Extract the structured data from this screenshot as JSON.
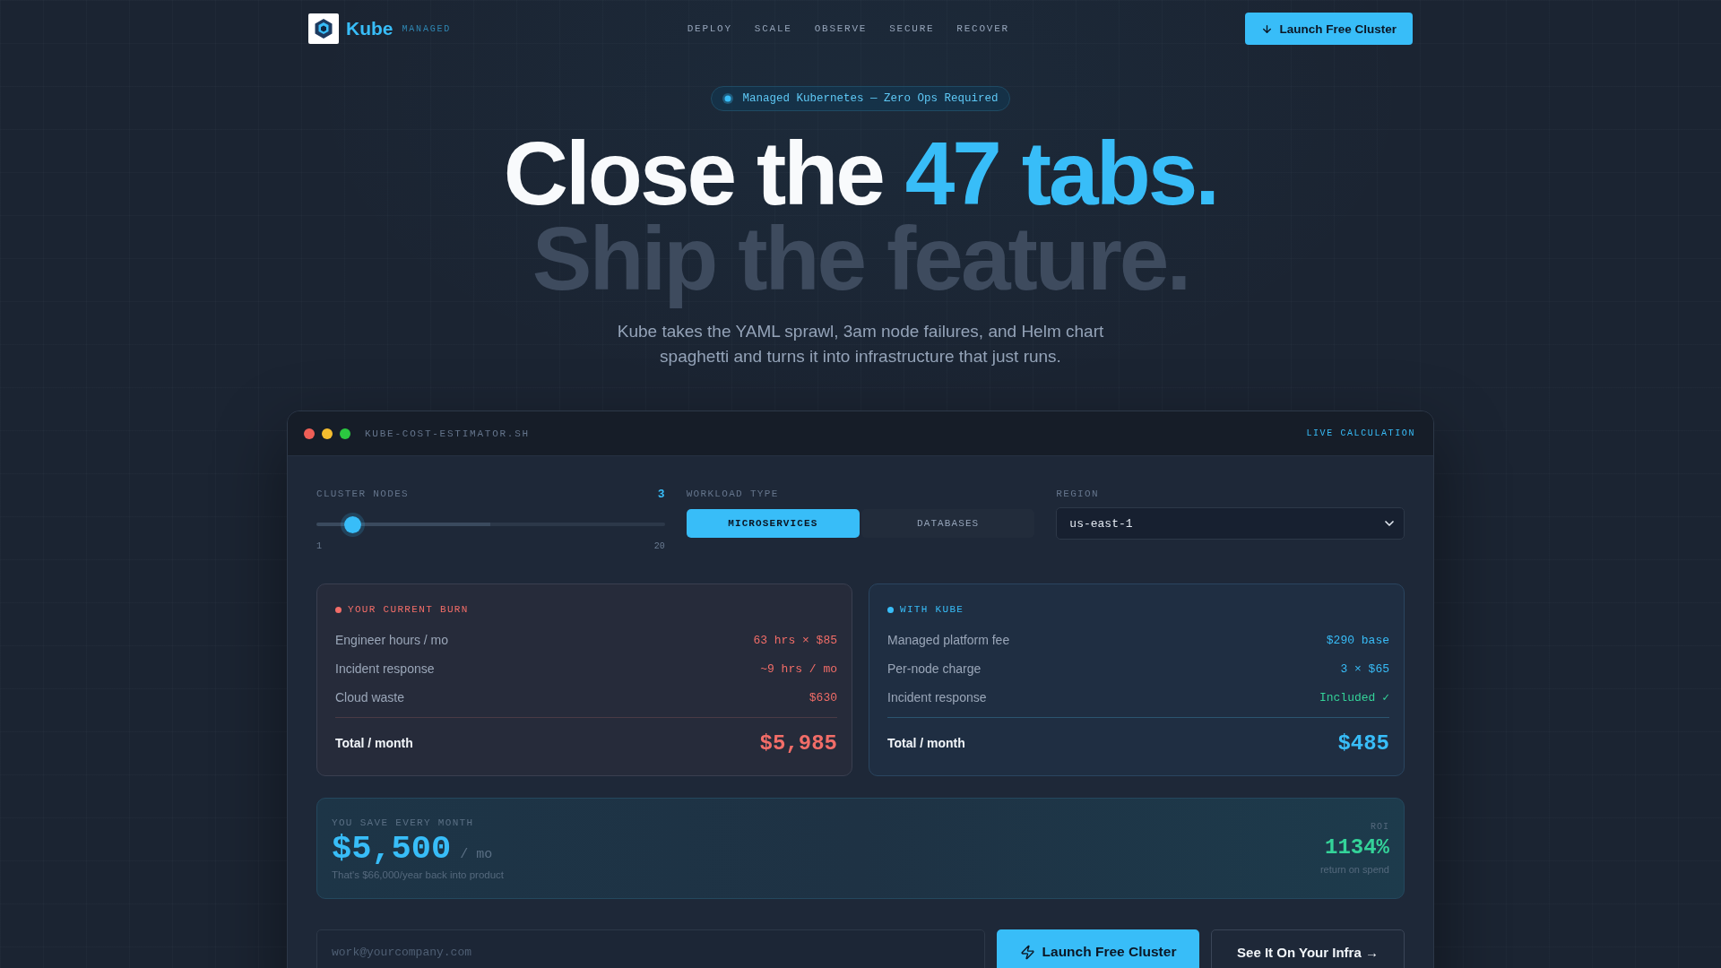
{
  "nav": {
    "brand": "Kube",
    "brand_tag": "MANAGED",
    "links": [
      {
        "label": "DEPLOY"
      },
      {
        "label": "SCALE"
      },
      {
        "label": "OBSERVE"
      },
      {
        "label": "SECURE"
      },
      {
        "label": "RECOVER"
      }
    ],
    "cta": "Launch Free Cluster"
  },
  "hero": {
    "badge": "Managed Kubernetes — Zero Ops Required",
    "headline": "Close the",
    "headline_accent": "47 tabs.",
    "subline": "Ship the feature.",
    "description": "Kube takes the YAML sprawl, 3am node failures, and Helm chart spaghetti and turns it into infrastructure that just runs."
  },
  "estimator": {
    "title": "KUBE-COST-ESTIMATOR.SH",
    "status": "LIVE CALCULATION",
    "nodes": {
      "label": "CLUSTER NODES",
      "value": "3",
      "level": 0.105,
      "min": "1",
      "max": "20"
    },
    "workload": {
      "label": "WORKLOAD TYPE",
      "options": [
        {
          "label": "MICROSERVICES",
          "selected": true
        },
        {
          "label": "DATABASES",
          "selected": false
        }
      ]
    },
    "region": {
      "label": "REGION",
      "value": "us-east-1"
    },
    "comparisons": [
      {
        "kind": "current",
        "title": "YOUR CURRENT BURN",
        "rows": [
          {
            "label": "Engineer hours / mo",
            "value": "63 hrs × $85",
            "kind": "cost"
          },
          {
            "label": "Incident response",
            "value": "~9 hrs / mo",
            "kind": "cost"
          },
          {
            "label": "Cloud waste",
            "value": "$630",
            "kind": "cost"
          }
        ],
        "total_label": "Total / month",
        "total": "$5,985"
      },
      {
        "kind": "kube",
        "title": "WITH KUBE",
        "rows": [
          {
            "label": "Managed platform fee",
            "value": "$290 base",
            "kind": "cost"
          },
          {
            "label": "Per-node charge",
            "value": "3 × $65",
            "kind": "cost"
          },
          {
            "label": "Incident response",
            "value": "Included ✓",
            "kind": "included"
          }
        ],
        "total_label": "Total / month",
        "total": "$485"
      }
    ],
    "savings": {
      "label": "YOU SAVE EVERY MONTH",
      "amount": "$5,500",
      "unit": "/ mo",
      "note": "That's $66,000/year back into product",
      "roi_label": "ROI",
      "roi": "1134%",
      "roi_note": "return on spend"
    },
    "signup": {
      "placeholder": "work@yourcompany.com",
      "primary": "Launch Free Cluster",
      "secondary": "See It On Your Infra →"
    }
  }
}
